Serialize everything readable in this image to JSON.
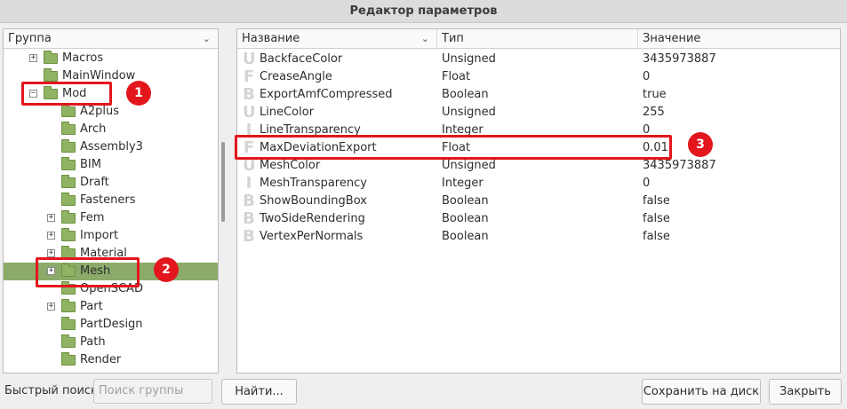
{
  "window": {
    "title": "Редактор параметров"
  },
  "tree": {
    "header": "Группа",
    "items": [
      {
        "label": "Macros",
        "indent": 1,
        "expander": "+",
        "selected": false
      },
      {
        "label": "MainWindow",
        "indent": 1,
        "expander": "",
        "selected": false
      },
      {
        "label": "Mod",
        "indent": 1,
        "expander": "−",
        "selected": false
      },
      {
        "label": "A2plus",
        "indent": 2,
        "expander": "",
        "selected": false
      },
      {
        "label": "Arch",
        "indent": 2,
        "expander": "",
        "selected": false
      },
      {
        "label": "Assembly3",
        "indent": 2,
        "expander": "",
        "selected": false
      },
      {
        "label": "BIM",
        "indent": 2,
        "expander": "",
        "selected": false
      },
      {
        "label": "Draft",
        "indent": 2,
        "expander": "",
        "selected": false
      },
      {
        "label": "Fasteners",
        "indent": 2,
        "expander": "",
        "selected": false
      },
      {
        "label": "Fem",
        "indent": 2,
        "expander": "+",
        "selected": false
      },
      {
        "label": "Import",
        "indent": 2,
        "expander": "+",
        "selected": false
      },
      {
        "label": "Material",
        "indent": 2,
        "expander": "+",
        "selected": false
      },
      {
        "label": "Mesh",
        "indent": 2,
        "expander": "+",
        "selected": true
      },
      {
        "label": "OpenSCAD",
        "indent": 2,
        "expander": "",
        "selected": false
      },
      {
        "label": "Part",
        "indent": 2,
        "expander": "+",
        "selected": false
      },
      {
        "label": "PartDesign",
        "indent": 2,
        "expander": "",
        "selected": false
      },
      {
        "label": "Path",
        "indent": 2,
        "expander": "",
        "selected": false
      },
      {
        "label": "Render",
        "indent": 2,
        "expander": "",
        "selected": false
      }
    ]
  },
  "params": {
    "columns": {
      "name": "Название",
      "type": "Тип",
      "value": "Значение"
    },
    "rows": [
      {
        "icon": "U",
        "name": "BackfaceColor",
        "type": "Unsigned",
        "value": "3435973887"
      },
      {
        "icon": "F",
        "name": "CreaseAngle",
        "type": "Float",
        "value": "0"
      },
      {
        "icon": "B",
        "name": "ExportAmfCompressed",
        "type": "Boolean",
        "value": "true"
      },
      {
        "icon": "U",
        "name": "LineColor",
        "type": "Unsigned",
        "value": "255"
      },
      {
        "icon": "I",
        "name": "LineTransparency",
        "type": "Integer",
        "value": "0"
      },
      {
        "icon": "F",
        "name": "MaxDeviationExport",
        "type": "Float",
        "value": "0.01"
      },
      {
        "icon": "U",
        "name": "MeshColor",
        "type": "Unsigned",
        "value": "3435973887"
      },
      {
        "icon": "I",
        "name": "MeshTransparency",
        "type": "Integer",
        "value": "0"
      },
      {
        "icon": "B",
        "name": "ShowBoundingBox",
        "type": "Boolean",
        "value": "false"
      },
      {
        "icon": "B",
        "name": "TwoSideRendering",
        "type": "Boolean",
        "value": "false"
      },
      {
        "icon": "B",
        "name": "VertexPerNormals",
        "type": "Boolean",
        "value": "false"
      }
    ]
  },
  "bottom": {
    "quick_search_label": "Быстрый поиск",
    "quick_search_placeholder": "Поиск группы",
    "find_button": "Найти...",
    "save_button": "Сохранить на диск",
    "close_button": "Закрыть"
  },
  "annotations": [
    {
      "number": "1"
    },
    {
      "number": "2"
    },
    {
      "number": "3"
    }
  ],
  "colors": {
    "selection": "#8cab6a",
    "folder": "#8fb363",
    "annotation": "#e3161d"
  }
}
